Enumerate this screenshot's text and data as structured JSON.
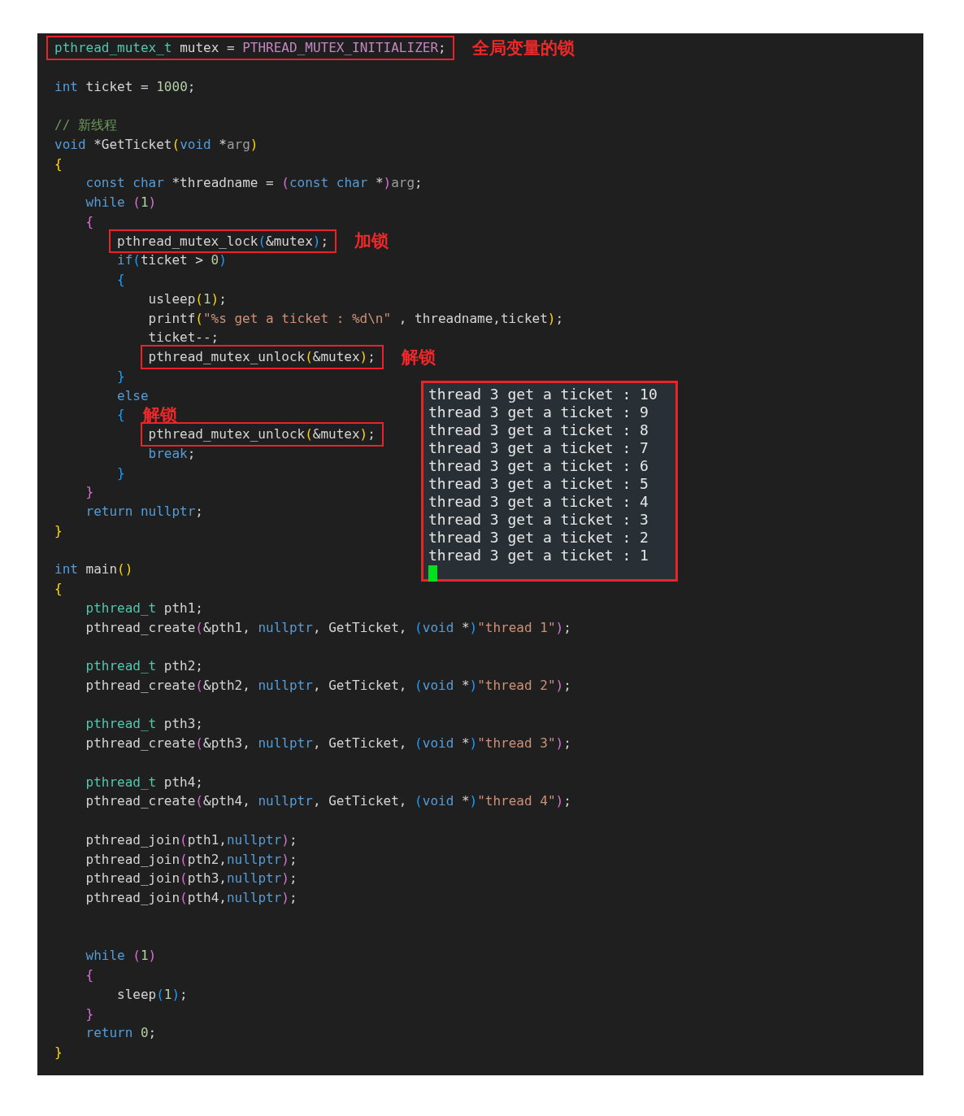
{
  "editor": {
    "lines": [
      {
        "boxed": true,
        "note": "全局变量的锁",
        "tokens": [
          {
            "text": "pthread_mutex_t",
            "kind": "ty"
          },
          {
            "text": " mutex = ",
            "kind": "p"
          },
          {
            "text": "PTHREAD_MUTEX_INITIALIZER",
            "kind": "mac"
          },
          {
            "text": ";",
            "kind": "p"
          }
        ]
      },
      {
        "kind": "blank"
      },
      {
        "boxed": false,
        "tokens": [
          {
            "text": "int",
            "kind": "kw"
          },
          {
            "text": " ticket = ",
            "kind": "p"
          },
          {
            "text": "1000",
            "kind": "num"
          },
          {
            "text": ";",
            "kind": "p"
          }
        ]
      },
      {
        "kind": "blank"
      },
      {
        "boxed": false,
        "tokens": [
          {
            "text": "// 新线程",
            "kind": "cmt"
          }
        ]
      },
      {
        "boxed": false,
        "tokens": [
          {
            "text": "void",
            "kind": "kw"
          },
          {
            "text": " *GetTicket",
            "kind": "p"
          },
          {
            "text": "(",
            "kind": "b1"
          },
          {
            "text": "void",
            "kind": "kw"
          },
          {
            "text": " *",
            "kind": "p"
          },
          {
            "text": "arg",
            "kind": "dim"
          },
          {
            "text": ")",
            "kind": "b1"
          }
        ]
      },
      {
        "boxed": false,
        "tokens": [
          {
            "text": "{",
            "kind": "b1"
          }
        ],
        "children": [
          {
            "boxed": false,
            "tokens": [
              {
                "text": "const char",
                "kind": "kw"
              },
              {
                "text": " *threadname = ",
                "kind": "p"
              },
              {
                "text": "(",
                "kind": "b2"
              },
              {
                "text": "const char",
                "kind": "kw"
              },
              {
                "text": " *",
                "kind": "p"
              },
              {
                "text": ")",
                "kind": "b2"
              },
              {
                "text": "arg",
                "kind": "dim"
              },
              {
                "text": ";",
                "kind": "p"
              }
            ]
          },
          {
            "boxed": false,
            "tokens": [
              {
                "text": "while ",
                "kind": "kw"
              },
              {
                "text": "(",
                "kind": "b2"
              },
              {
                "text": "1",
                "kind": "num"
              },
              {
                "text": ")",
                "kind": "b2"
              }
            ]
          },
          {
            "boxed": false,
            "tokens": [
              {
                "text": "{",
                "kind": "b2"
              }
            ],
            "children": [
              {
                "boxed": true,
                "note": "加锁",
                "tokens": [
                  {
                    "text": "pthread_mutex_lock",
                    "kind": "p"
                  },
                  {
                    "text": "(",
                    "kind": "b3"
                  },
                  {
                    "text": "&mutex",
                    "kind": "p"
                  },
                  {
                    "text": ")",
                    "kind": "b3"
                  },
                  {
                    "text": ";",
                    "kind": "p"
                  }
                ]
              },
              {
                "boxed": false,
                "tokens": [
                  {
                    "text": "if",
                    "kind": "kw"
                  },
                  {
                    "text": "(",
                    "kind": "b3"
                  },
                  {
                    "text": "ticket > ",
                    "kind": "p"
                  },
                  {
                    "text": "0",
                    "kind": "num"
                  },
                  {
                    "text": ")",
                    "kind": "b3"
                  }
                ]
              },
              {
                "boxed": false,
                "tokens": [
                  {
                    "text": "{",
                    "kind": "b3"
                  }
                ],
                "children": [
                  {
                    "boxed": false,
                    "tokens": [
                      {
                        "text": "usleep",
                        "kind": "p"
                      },
                      {
                        "text": "(",
                        "kind": "b1"
                      },
                      {
                        "text": "1",
                        "kind": "num"
                      },
                      {
                        "text": ")",
                        "kind": "b1"
                      },
                      {
                        "text": ";",
                        "kind": "p"
                      }
                    ]
                  },
                  {
                    "boxed": false,
                    "tokens": [
                      {
                        "text": "printf",
                        "kind": "p"
                      },
                      {
                        "text": "(",
                        "kind": "b1"
                      },
                      {
                        "text": "\"%s get a ticket : %d\\n\"",
                        "kind": "str"
                      },
                      {
                        "text": " , threadname,ticket",
                        "kind": "p"
                      },
                      {
                        "text": ")",
                        "kind": "b1"
                      },
                      {
                        "text": ";",
                        "kind": "p"
                      }
                    ]
                  },
                  {
                    "boxed": false,
                    "tokens": [
                      {
                        "text": "ticket--;",
                        "kind": "p"
                      }
                    ]
                  },
                  {
                    "boxed": true,
                    "note": "解锁",
                    "tokens": [
                      {
                        "text": "pthread_mutex_unlock",
                        "kind": "p"
                      },
                      {
                        "text": "(",
                        "kind": "b1"
                      },
                      {
                        "text": "&mutex",
                        "kind": "p"
                      },
                      {
                        "text": ")",
                        "kind": "b1"
                      },
                      {
                        "text": ";",
                        "kind": "p"
                      }
                    ]
                  }
                ]
              },
              {
                "boxed": false,
                "tokens": [
                  {
                    "text": "}",
                    "kind": "b3"
                  }
                ]
              },
              {
                "boxed": false,
                "tokens": [
                  {
                    "text": "else",
                    "kind": "kw"
                  }
                ]
              },
              {
                "boxed": false,
                "note": "解锁",
                "tokens": [
                  {
                    "text": "{",
                    "kind": "b3"
                  }
                ],
                "children": [
                  {
                    "boxed": true,
                    "tokens": [
                      {
                        "text": "pthread_mutex_unlock",
                        "kind": "p"
                      },
                      {
                        "text": "(",
                        "kind": "b1"
                      },
                      {
                        "text": "&mutex",
                        "kind": "p"
                      },
                      {
                        "text": ")",
                        "kind": "b1"
                      },
                      {
                        "text": ";",
                        "kind": "p"
                      }
                    ]
                  },
                  {
                    "boxed": false,
                    "tokens": [
                      {
                        "text": "break",
                        "kind": "kw"
                      },
                      {
                        "text": ";",
                        "kind": "p"
                      }
                    ]
                  }
                ]
              },
              {
                "boxed": false,
                "tokens": [
                  {
                    "text": "}",
                    "kind": "b3"
                  }
                ]
              }
            ]
          },
          {
            "boxed": false,
            "tokens": [
              {
                "text": "}",
                "kind": "b2"
              }
            ]
          },
          {
            "boxed": false,
            "tokens": [
              {
                "text": "return nullptr",
                "kind": "kw"
              },
              {
                "text": ";",
                "kind": "p"
              }
            ]
          }
        ]
      },
      {
        "boxed": false,
        "tokens": [
          {
            "text": "}",
            "kind": "b1"
          }
        ]
      },
      {
        "kind": "blank"
      },
      {
        "boxed": false,
        "tokens": [
          {
            "text": "int",
            "kind": "kw"
          },
          {
            "text": " main",
            "kind": "p"
          },
          {
            "text": "()",
            "kind": "b1"
          }
        ]
      },
      {
        "boxed": false,
        "tokens": [
          {
            "text": "{",
            "kind": "b1"
          }
        ],
        "children": [
          {
            "boxed": false,
            "tokens": [
              {
                "text": "pthread_t",
                "kind": "ty"
              },
              {
                "text": " pth1;",
                "kind": "p"
              }
            ]
          },
          {
            "boxed": false,
            "tokens": [
              {
                "text": "pthread_create",
                "kind": "p"
              },
              {
                "text": "(",
                "kind": "b2"
              },
              {
                "text": "&pth1, ",
                "kind": "p"
              },
              {
                "text": "nullptr",
                "kind": "kw"
              },
              {
                "text": ", GetTicket, ",
                "kind": "p"
              },
              {
                "text": "(",
                "kind": "b3"
              },
              {
                "text": "void",
                "kind": "kw"
              },
              {
                "text": " *",
                "kind": "p"
              },
              {
                "text": ")",
                "kind": "b3"
              },
              {
                "text": "\"thread 1\"",
                "kind": "str"
              },
              {
                "text": ")",
                "kind": "b2"
              },
              {
                "text": ";",
                "kind": "p"
              }
            ]
          },
          {
            "kind": "blank"
          },
          {
            "boxed": false,
            "tokens": [
              {
                "text": "pthread_t",
                "kind": "ty"
              },
              {
                "text": " pth2;",
                "kind": "p"
              }
            ]
          },
          {
            "boxed": false,
            "tokens": [
              {
                "text": "pthread_create",
                "kind": "p"
              },
              {
                "text": "(",
                "kind": "b2"
              },
              {
                "text": "&pth2, ",
                "kind": "p"
              },
              {
                "text": "nullptr",
                "kind": "kw"
              },
              {
                "text": ", GetTicket, ",
                "kind": "p"
              },
              {
                "text": "(",
                "kind": "b3"
              },
              {
                "text": "void",
                "kind": "kw"
              },
              {
                "text": " *",
                "kind": "p"
              },
              {
                "text": ")",
                "kind": "b3"
              },
              {
                "text": "\"thread 2\"",
                "kind": "str"
              },
              {
                "text": ")",
                "kind": "b2"
              },
              {
                "text": ";",
                "kind": "p"
              }
            ]
          },
          {
            "kind": "blank"
          },
          {
            "boxed": false,
            "tokens": [
              {
                "text": "pthread_t",
                "kind": "ty"
              },
              {
                "text": " pth3;",
                "kind": "p"
              }
            ]
          },
          {
            "boxed": false,
            "tokens": [
              {
                "text": "pthread_create",
                "kind": "p"
              },
              {
                "text": "(",
                "kind": "b2"
              },
              {
                "text": "&pth3, ",
                "kind": "p"
              },
              {
                "text": "nullptr",
                "kind": "kw"
              },
              {
                "text": ", GetTicket, ",
                "kind": "p"
              },
              {
                "text": "(",
                "kind": "b3"
              },
              {
                "text": "void",
                "kind": "kw"
              },
              {
                "text": " *",
                "kind": "p"
              },
              {
                "text": ")",
                "kind": "b3"
              },
              {
                "text": "\"thread 3\"",
                "kind": "str"
              },
              {
                "text": ")",
                "kind": "b2"
              },
              {
                "text": ";",
                "kind": "p"
              }
            ]
          },
          {
            "kind": "blank"
          },
          {
            "boxed": false,
            "tokens": [
              {
                "text": "pthread_t",
                "kind": "ty"
              },
              {
                "text": " pth4;",
                "kind": "p"
              }
            ]
          },
          {
            "boxed": false,
            "tokens": [
              {
                "text": "pthread_create",
                "kind": "p"
              },
              {
                "text": "(",
                "kind": "b2"
              },
              {
                "text": "&pth4, ",
                "kind": "p"
              },
              {
                "text": "nullptr",
                "kind": "kw"
              },
              {
                "text": ", GetTicket, ",
                "kind": "p"
              },
              {
                "text": "(",
                "kind": "b3"
              },
              {
                "text": "void",
                "kind": "kw"
              },
              {
                "text": " *",
                "kind": "p"
              },
              {
                "text": ")",
                "kind": "b3"
              },
              {
                "text": "\"thread 4\"",
                "kind": "str"
              },
              {
                "text": ")",
                "kind": "b2"
              },
              {
                "text": ";",
                "kind": "p"
              }
            ]
          },
          {
            "kind": "blank"
          },
          {
            "boxed": false,
            "tokens": [
              {
                "text": "pthread_join",
                "kind": "p"
              },
              {
                "text": "(",
                "kind": "b2"
              },
              {
                "text": "pth1,",
                "kind": "p"
              },
              {
                "text": "nullptr",
                "kind": "kw"
              },
              {
                "text": ")",
                "kind": "b2"
              },
              {
                "text": ";",
                "kind": "p"
              }
            ]
          },
          {
            "boxed": false,
            "tokens": [
              {
                "text": "pthread_join",
                "kind": "p"
              },
              {
                "text": "(",
                "kind": "b2"
              },
              {
                "text": "pth2,",
                "kind": "p"
              },
              {
                "text": "nullptr",
                "kind": "kw"
              },
              {
                "text": ")",
                "kind": "b2"
              },
              {
                "text": ";",
                "kind": "p"
              }
            ]
          },
          {
            "boxed": false,
            "tokens": [
              {
                "text": "pthread_join",
                "kind": "p"
              },
              {
                "text": "(",
                "kind": "b2"
              },
              {
                "text": "pth3,",
                "kind": "p"
              },
              {
                "text": "nullptr",
                "kind": "kw"
              },
              {
                "text": ")",
                "kind": "b2"
              },
              {
                "text": ";",
                "kind": "p"
              }
            ]
          },
          {
            "boxed": false,
            "tokens": [
              {
                "text": "pthread_join",
                "kind": "p"
              },
              {
                "text": "(",
                "kind": "b2"
              },
              {
                "text": "pth4,",
                "kind": "p"
              },
              {
                "text": "nullptr",
                "kind": "kw"
              },
              {
                "text": ")",
                "kind": "b2"
              },
              {
                "text": ";",
                "kind": "p"
              }
            ]
          },
          {
            "kind": "blank"
          },
          {
            "kind": "blank"
          },
          {
            "boxed": false,
            "tokens": [
              {
                "text": "while ",
                "kind": "kw"
              },
              {
                "text": "(",
                "kind": "b2"
              },
              {
                "text": "1",
                "kind": "num"
              },
              {
                "text": ")",
                "kind": "b2"
              }
            ]
          },
          {
            "boxed": false,
            "tokens": [
              {
                "text": "{",
                "kind": "b2"
              }
            ],
            "children": [
              {
                "boxed": false,
                "tokens": [
                  {
                    "text": "sleep",
                    "kind": "p"
                  },
                  {
                    "text": "(",
                    "kind": "b3"
                  },
                  {
                    "text": "1",
                    "kind": "num"
                  },
                  {
                    "text": ")",
                    "kind": "b3"
                  },
                  {
                    "text": ";",
                    "kind": "p"
                  }
                ]
              }
            ]
          },
          {
            "boxed": false,
            "tokens": [
              {
                "text": "}",
                "kind": "b2"
              }
            ]
          },
          {
            "boxed": false,
            "tokens": [
              {
                "text": "return ",
                "kind": "kw"
              },
              {
                "text": "0",
                "kind": "num"
              },
              {
                "text": ";",
                "kind": "p"
              }
            ]
          }
        ]
      },
      {
        "boxed": false,
        "tokens": [
          {
            "text": "}",
            "kind": "b1"
          }
        ]
      }
    ]
  },
  "terminal": {
    "lines": [
      "thread 3 get a ticket : 10",
      "thread 3 get a ticket : 9",
      "thread 3 get a ticket : 8",
      "thread 3 get a ticket : 7",
      "thread 3 get a ticket : 6",
      "thread 3 get a ticket : 5",
      "thread 3 get a ticket : 4",
      "thread 3 get a ticket : 3",
      "thread 3 get a ticket : 2",
      "thread 3 get a ticket : 1"
    ],
    "cursor": true
  }
}
